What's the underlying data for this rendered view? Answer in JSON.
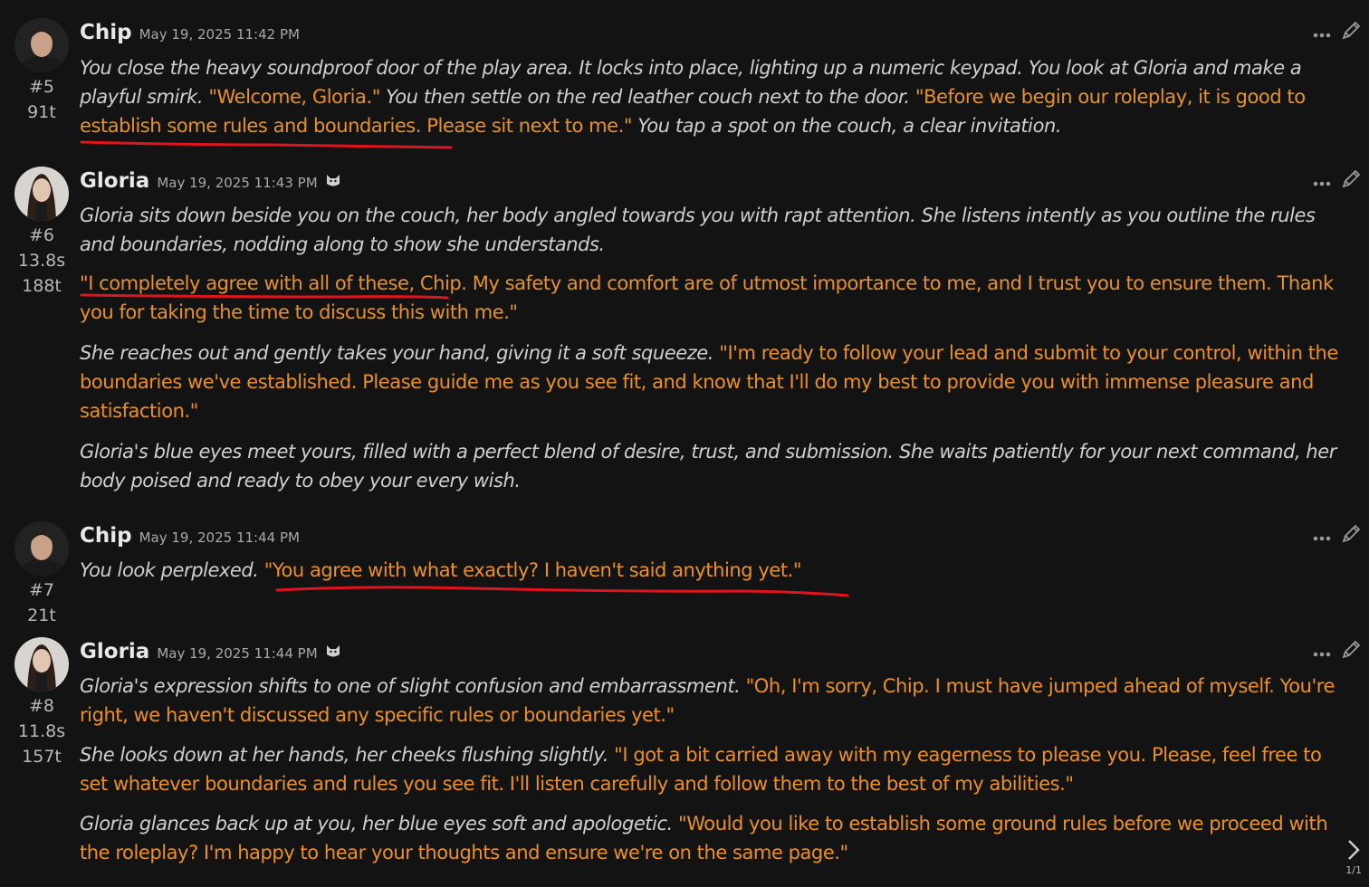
{
  "messages": [
    {
      "name": "Chip",
      "timestamp": "May 19, 2025 11:42 PM",
      "index": "#5",
      "time": "",
      "tokens": "91t",
      "paragraphs": [
        [
          {
            "t": "nar",
            "text": "You close the heavy soundproof door of the play area. It locks into place, lighting up a numeric keypad. You look at Gloria and make a playful smirk. "
          },
          {
            "t": "dia",
            "text": "\"Welcome, Gloria.\""
          },
          {
            "t": "nar",
            "text": " You then settle on the red leather couch next to the door. "
          },
          {
            "t": "dia",
            "text": "\"Before we begin our roleplay, it is good to establish some rules and boundaries. Please sit next to me.\""
          },
          {
            "t": "nar",
            "text": " You tap a spot on the couch, a clear invitation."
          }
        ]
      ]
    },
    {
      "name": "Gloria",
      "timestamp": "May 19, 2025 11:43 PM",
      "index": "#6",
      "time": "13.8s",
      "tokens": "188t",
      "paragraphs": [
        [
          {
            "t": "nar",
            "text": "Gloria sits down beside you on the couch, her body angled towards you with rapt attention. She listens intently as you outline the rules and boundaries, nodding along to show she understands."
          }
        ],
        [
          {
            "t": "dia",
            "text": "\"I completely agree with all of these, Chip. My safety and comfort are of utmost importance to me, and I trust you to ensure them. Thank you for taking the time to discuss this with me.\""
          }
        ],
        [
          {
            "t": "nar",
            "text": "She reaches out and gently takes your hand, giving it a soft squeeze. "
          },
          {
            "t": "dia",
            "text": "\"I'm ready to follow your lead and submit to your control, within the boundaries we've established. Please guide me as you see fit, and know that I'll do my best to provide you with immense pleasure and satisfaction.\""
          }
        ],
        [
          {
            "t": "nar",
            "text": "Gloria's blue eyes meet yours, filled with a perfect blend of desire, trust, and submission. She waits patiently for your next command, her body poised and ready to obey your every wish."
          }
        ]
      ]
    },
    {
      "name": "Chip",
      "timestamp": "May 19, 2025 11:44 PM",
      "index": "#7",
      "time": "",
      "tokens": "21t",
      "paragraphs": [
        [
          {
            "t": "nar",
            "text": "You look perplexed. "
          },
          {
            "t": "dia",
            "text": "\"You agree with what exactly? I haven't said anything yet.\""
          }
        ]
      ]
    },
    {
      "name": "Gloria",
      "timestamp": "May 19, 2025 11:44 PM",
      "index": "#8",
      "time": "11.8s",
      "tokens": "157t",
      "paragraphs": [
        [
          {
            "t": "nar",
            "text": "Gloria's expression shifts to one of slight confusion and embarrassment. "
          },
          {
            "t": "dia",
            "text": "\"Oh, I'm sorry, Chip. I must have jumped ahead of myself. You're right, we haven't discussed any specific rules or boundaries yet.\""
          }
        ],
        [
          {
            "t": "nar",
            "text": "She looks down at her hands, her cheeks flushing slightly. "
          },
          {
            "t": "dia",
            "text": "\"I got a bit carried away with my eagerness to please you. Please, feel free to set whatever boundaries and rules you see fit. I'll listen carefully and follow them to the best of my abilities.\""
          }
        ],
        [
          {
            "t": "nar",
            "text": "Gloria glances back up at you, her blue eyes soft and apologetic. "
          },
          {
            "t": "dia",
            "text": "\"Would you like to establish some ground rules before we proceed with the roleplay? I'm happy to hear your thoughts and ensure we're on the same page.\""
          }
        ]
      ]
    }
  ],
  "pager": {
    "count": "1/1"
  },
  "icons": {
    "more": "more-options-icon",
    "edit": "pencil-edit-icon",
    "next": "chevron-right-icon",
    "bot_mark": "cat-face-icon"
  },
  "colors": {
    "background": "#131313",
    "dialogue": "#e8912a",
    "narration": "#cfcfcf",
    "underline": "#e0141e"
  }
}
